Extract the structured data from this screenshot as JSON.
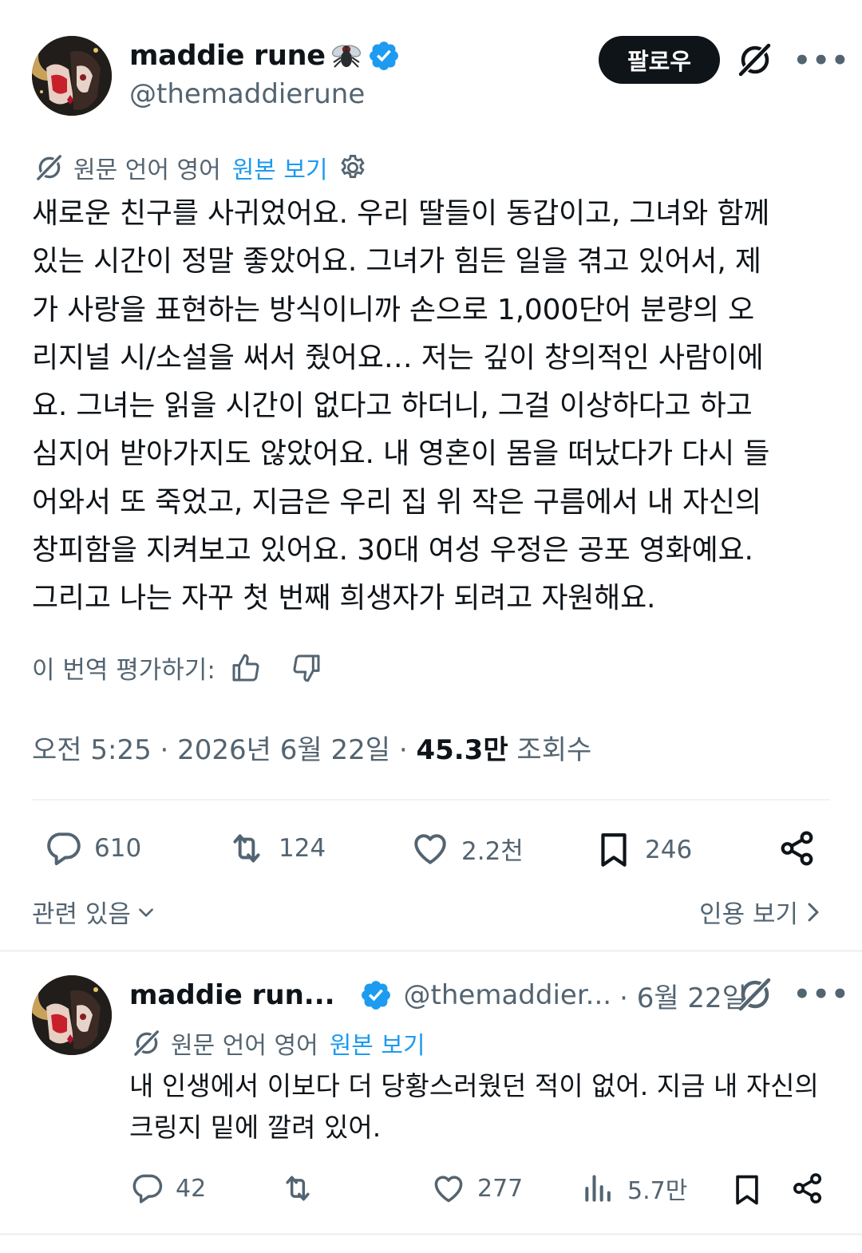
{
  "tweet": {
    "display_name": "maddie rune",
    "handle": "@themaddierune",
    "follow_label": "팔로우",
    "more_label": "•••",
    "translation": {
      "label": "원문 언어 영어",
      "link": "원본 보기"
    },
    "text_lines": [
      "새로운 친구를 사귀었어요. 우리 딸들이 동갑이고, 그녀와 함께",
      "있는 시간이 정말 좋았어요. 그녀가 힘든 일을 겪고 있어서, 제",
      "가 사랑을 표현하는 방식이니까 손으로 1,000단어 분량의 오",
      "리지널 시/소설을 써서 줬어요… 저는 깊이 창의적인 사람이에",
      "요. 그녀는 읽을 시간이 없다고 하더니, 그걸 이상하다고 하고",
      "심지어 받아가지도 않았어요. 내 영혼이 몸을 떠났다가 다시 들",
      "어와서 또 죽었고, 지금은 우리 집 위 작은 구름에서 내 자신의",
      "창피함을 지켜보고 있어요. 30대 여성 우정은 공포 영화예요.",
      "그리고 나는 자꾸 첫 번째 희생자가 되려고 자원해요."
    ],
    "rate_label": "이 번역 평가하기:",
    "time": "오전 5:25 · 2026년 6월 22일 · ",
    "views_count": "45.3만",
    "views_label": " 조회수",
    "stats": {
      "replies": "610",
      "retweets": "124",
      "likes": "2.2천",
      "bookmarks": "246"
    },
    "related_label": "관련 있음",
    "quotes_label": "인용 보기"
  },
  "reply": {
    "display_name": "maddie run...",
    "handle": "@themaddier...",
    "date": "· 6월 22일",
    "more_label": "•••",
    "translation": {
      "label": "원문 언어 영어",
      "link": "원본 보기"
    },
    "text_lines": [
      "내 인생에서 이보다 더 당황스러웠던 적이 없어. 지금 내 자신의",
      "크링지 밑에 깔려 있어."
    ],
    "stats": {
      "replies": "42",
      "likes": "277",
      "views": "5.7만"
    }
  },
  "colors": {
    "text": "#0f1419",
    "secondary": "#536471",
    "accent": "#1d9bf0",
    "divider": "#eff3f4"
  },
  "icons": [
    "verified-badge-icon",
    "fly-emoji-icon",
    "grok-translate-icon",
    "gear-icon",
    "thumbs-up-icon",
    "thumbs-down-icon",
    "reply-icon",
    "retweet-icon",
    "like-icon",
    "bookmark-icon",
    "share-icon",
    "views-icon",
    "chevron-down-icon",
    "chevron-right-icon"
  ]
}
